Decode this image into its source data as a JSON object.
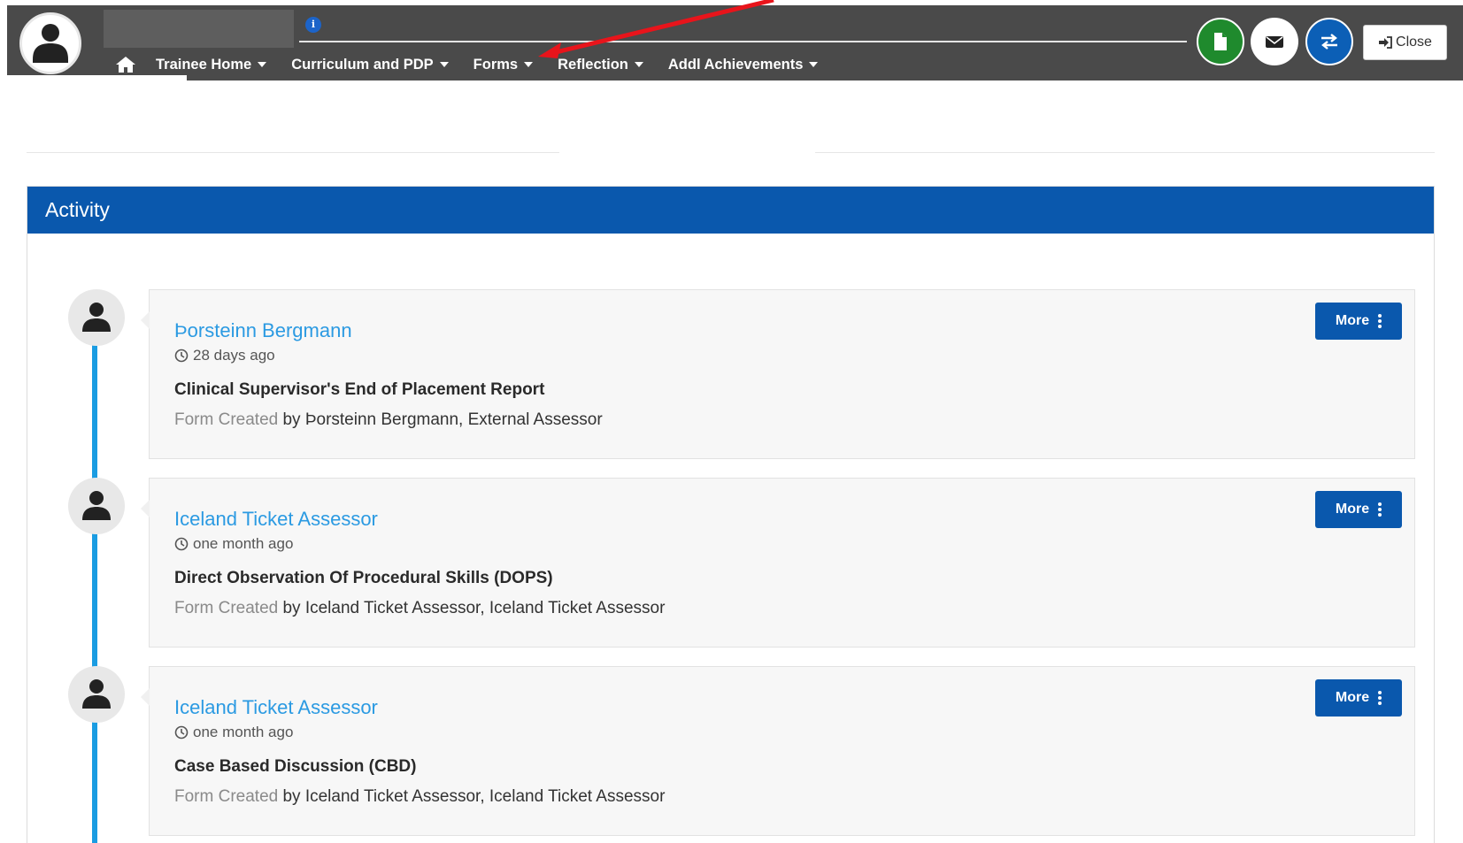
{
  "nav": {
    "home_icon": "home-icon",
    "info_icon_text": "i",
    "items": [
      {
        "label": "Trainee Home"
      },
      {
        "label": "Curriculum and PDP"
      },
      {
        "label": "Forms"
      },
      {
        "label": "Reflection"
      },
      {
        "label": "Addl Achievements"
      }
    ],
    "buttons": {
      "document_icon": "document-icon",
      "mail_icon": "envelope-icon",
      "switch_icon": "exchange-icon",
      "close_label": "Close"
    }
  },
  "colors": {
    "topbar": "#4a4a4a",
    "primary": "#0a58ad",
    "green": "#1f8a2d",
    "link": "#2b9ae2",
    "timeline": "#1a9ce2",
    "annotation": "#e8141b"
  },
  "panel": {
    "title": "Activity",
    "entries": [
      {
        "author": "Þorsteinn Bergmann",
        "time": "28 days ago",
        "title": "Clinical Supervisor's End of Placement Report",
        "action": "Form Created",
        "by": "by Þorsteinn Bergmann, External Assessor",
        "more_label": "More"
      },
      {
        "author": "Iceland Ticket Assessor",
        "time": "one month ago",
        "title": "Direct Observation Of Procedural Skills (DOPS)",
        "action": "Form Created",
        "by": "by Iceland Ticket Assessor, Iceland Ticket Assessor",
        "more_label": "More"
      },
      {
        "author": "Iceland Ticket Assessor",
        "time": "one month ago",
        "title": "Case Based Discussion (CBD)",
        "action": "Form Created",
        "by": "by Iceland Ticket Assessor, Iceland Ticket Assessor",
        "more_label": "More"
      }
    ]
  }
}
